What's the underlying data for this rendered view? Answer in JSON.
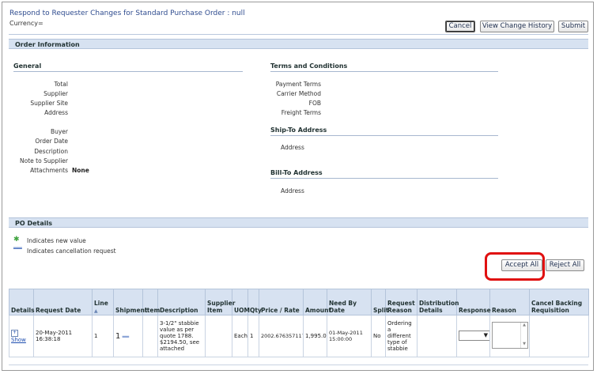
{
  "header": {
    "title": "Respond to Requester Changes for Standard Purchase Order : null",
    "currency": "Currency="
  },
  "toolbar": {
    "cancel_label": "Cancel",
    "view_change_history_label": "View Change History",
    "submit_label": "Submit"
  },
  "order_info": {
    "section_title": "Order Information",
    "general_title": "General",
    "general_fields": {
      "total": "Total",
      "supplier": "Supplier",
      "supplier_site": "Supplier Site",
      "address": "Address",
      "buyer": "Buyer",
      "order_date": "Order Date",
      "description": "Description",
      "note_to_supplier": "Note to Supplier",
      "attachments": "Attachments",
      "attachments_value": "None"
    },
    "terms_title": "Terms and Conditions",
    "terms_fields": {
      "payment_terms": "Payment Terms",
      "carrier_method": "Carrier Method",
      "fob": "FOB",
      "freight_terms": "Freight Terms"
    },
    "ship_to_title": "Ship-To Address",
    "ship_to_address_label": "Address",
    "bill_to_title": "Bill-To Address",
    "bill_to_address_label": "Address"
  },
  "po_details": {
    "section_title": "PO Details",
    "legend_new_value": "Indicates new value",
    "legend_cancellation": "Indicates cancellation request",
    "accept_all_label": "Accept All",
    "reject_all_label": "Reject All",
    "columns": [
      "Details",
      "Request Date",
      "Line",
      "Shipment",
      "Item",
      "Description",
      "Supplier Item",
      "UOM",
      "Qty",
      "Price / Rate",
      "Amount",
      "Need By Date",
      "Split",
      "Request Reason",
      "Distribution Details",
      "Response",
      "Reason",
      "Cancel Backing Requisition"
    ],
    "rows": [
      {
        "details": "Show",
        "request_date": "20-May-2011 16:38:18",
        "line": "1",
        "shipment": "1",
        "item": "",
        "description": "3-1/2\" stabbie value as per quote 1788. $2194.50, see attached",
        "supplier_item": "",
        "uom": "Each",
        "qty": "1",
        "price": "2002.6763571177",
        "amount": "1,995.00",
        "need_by_date": "01-May-2011 15:00:00",
        "split": "No",
        "request_reason": "Ordering a different type of stabbie",
        "distribution_details": "",
        "response": "",
        "reason": "",
        "cancel_backing": ""
      }
    ]
  },
  "colors": {
    "header_bg": "#d7e2f1",
    "title_blue": "#2f4c8f",
    "highlight_red": "#e01010"
  }
}
